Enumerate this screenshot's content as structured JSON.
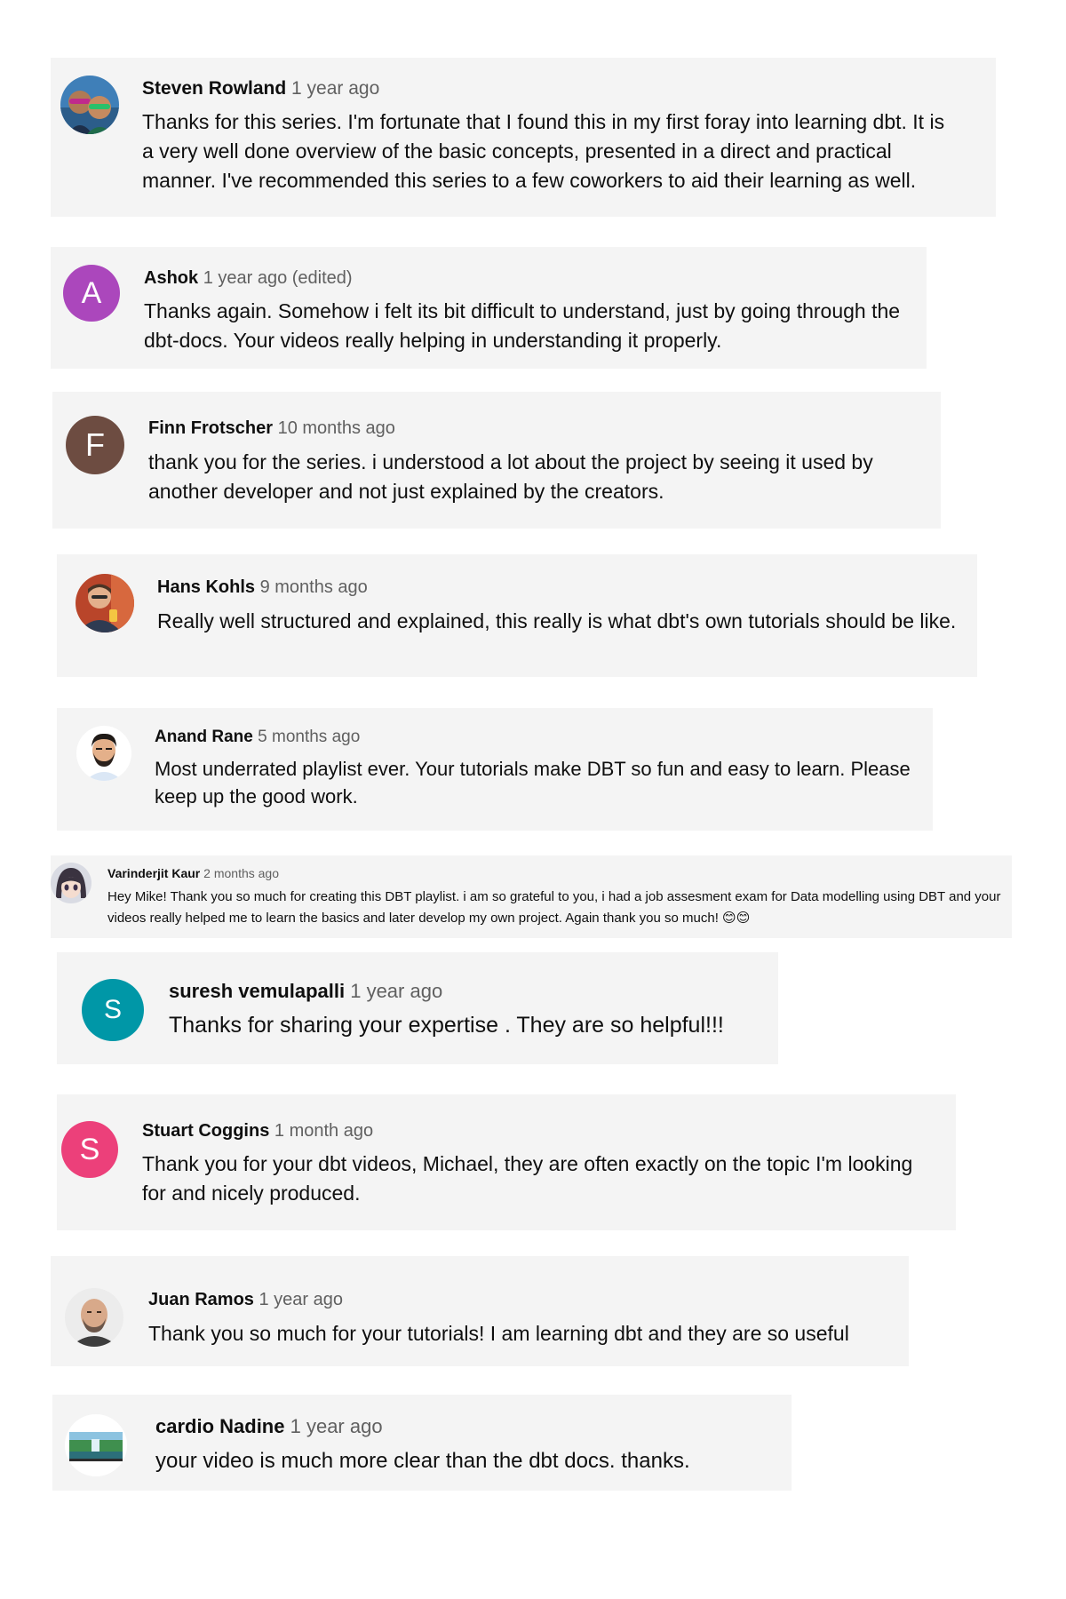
{
  "comments": [
    {
      "author": "Steven Rowland",
      "time": "1 year ago",
      "text": "Thanks for this series. I'm fortunate that I found this in my first foray into learning dbt. It is a very well done overview of the basic concepts, presented in a direct and practical manner. I've recommended this series to a few coworkers to aid their learning as well.",
      "avatar_icon": "two-people-photo-icon"
    },
    {
      "author": "Ashok",
      "time": "1 year ago (edited)",
      "text": "Thanks again. Somehow i felt its bit difficult to understand, just by going through the dbt-docs. Your videos really helping in understanding it properly.",
      "avatar_letter": "A",
      "avatar_color": "#ab47bc"
    },
    {
      "author": "Finn Frotscher",
      "time": "10 months ago",
      "text": "thank you for the series. i understood a lot about the project by seeing it used by another developer and not just explained by the creators.",
      "avatar_letter": "F",
      "avatar_color": "#6d4c41"
    },
    {
      "author": "Hans Kohls",
      "time": "9 months ago",
      "text": "Really well structured and explained, this really is what dbt's own tutorials should be like.",
      "avatar_icon": "person-photo-icon"
    },
    {
      "author": "Anand Rane",
      "time": "5 months ago",
      "text": "Most underrated playlist ever. Your tutorials make DBT so fun and easy to learn. Please keep up the good work.",
      "avatar_icon": "bearded-man-cartoon-icon"
    },
    {
      "author": "Varinderjit Kaur",
      "time": "2 months ago",
      "text": "Hey Mike! Thank you so much for creating this DBT playlist. i am so grateful to you, i had a job assesment exam for Data modelling using DBT and your videos really helped me to learn the basics and later develop my own project. Again thank you so much! 😊😊",
      "avatar_icon": "anime-girl-icon"
    },
    {
      "author": "suresh vemulapalli",
      "time": "1 year ago",
      "text": "Thanks for sharing your expertise . They are so helpful!!!",
      "avatar_letter": "S",
      "avatar_color": "#0097a7"
    },
    {
      "author": "Stuart Coggins",
      "time": "1 month ago",
      "text": "Thank you for your dbt videos, Michael, they are often exactly on the topic I'm looking for and nicely produced.",
      "avatar_letter": "S",
      "avatar_color": "#ec407a"
    },
    {
      "author": "Juan Ramos",
      "time": "1 year ago",
      "text": "Thank you so much for your tutorials! I am learning dbt and they are so useful",
      "avatar_icon": "bald-man-photo-icon"
    },
    {
      "author": "cardio Nadine",
      "time": "1 year ago",
      "text": "your video is much more clear than the dbt docs. thanks.",
      "avatar_icon": "waterfall-landscape-icon"
    }
  ]
}
